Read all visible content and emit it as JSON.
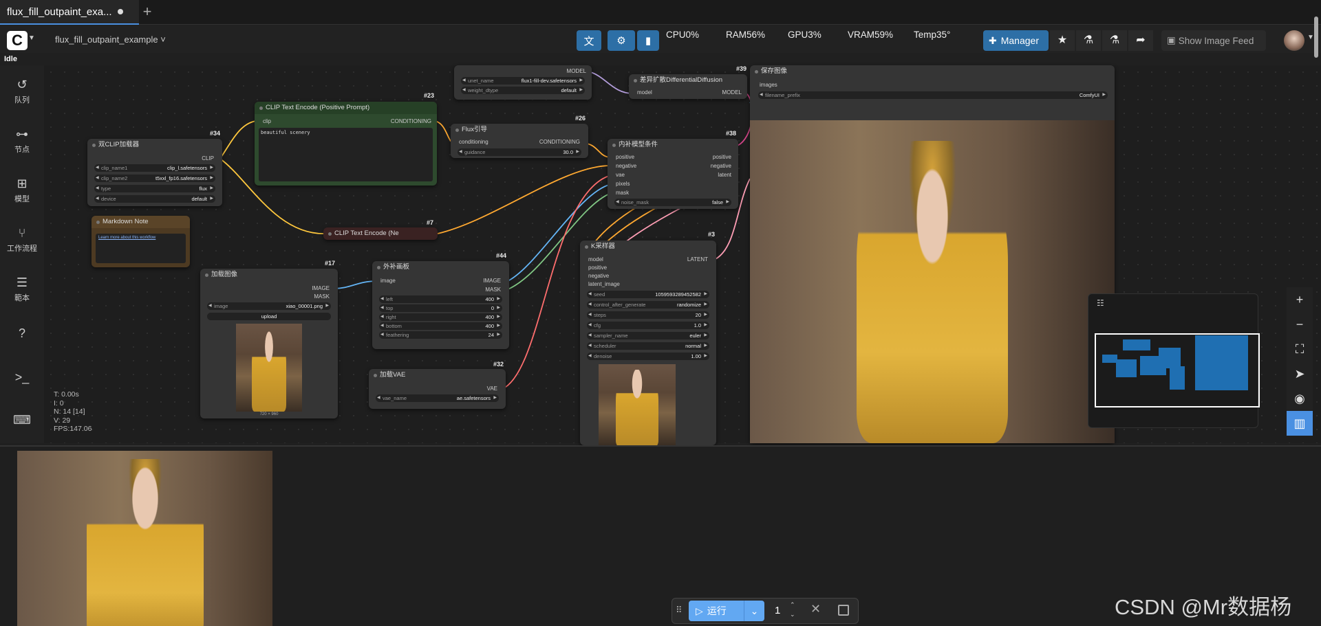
{
  "tabs": [
    {
      "label": "flux_fill_outpaint_exa..."
    }
  ],
  "topbar": {
    "workflow_name": "flux_fill_outpaint_example",
    "stats": {
      "cpu": "CPU0%",
      "ram": "RAM56%",
      "gpu": "GPU3%",
      "vram": "VRAM59%",
      "temp": "Temp35°"
    },
    "manager_label": "Manager",
    "show_feed_label": "Show Image Feed"
  },
  "status": "Idle",
  "sidebar": {
    "items": [
      {
        "label": "队列",
        "icon": "history-icon"
      },
      {
        "label": "节点",
        "icon": "node-icon"
      },
      {
        "label": "模型",
        "icon": "model-icon"
      },
      {
        "label": "工作流程",
        "icon": "workflow-icon"
      },
      {
        "label": "範本",
        "icon": "template-icon"
      }
    ]
  },
  "canvas_stats": {
    "t": "T: 0.00s",
    "i": "I: 0",
    "n": "N: 14 [14]",
    "v": "V: 29",
    "fps": "FPS:147.06"
  },
  "nodes": {
    "unet": {
      "out_model": "MODEL",
      "unet_name_k": "unet_name",
      "unet_name_v": "flux1-fill-dev.safetensors",
      "wdtype_k": "weight_dtype",
      "wdtype_v": "default"
    },
    "diffdiff": {
      "id": "#39",
      "title": "差异扩散DifferentialDiffusion",
      "in_model": "model",
      "out_model": "MODEL"
    },
    "save": {
      "title": "保存图像",
      "in_images": "images",
      "prefix_k": "filename_prefix",
      "prefix_v": "ComfyUI"
    },
    "clip_pos": {
      "id": "#23",
      "title": "CLIP Text Encode (Positive Prompt)",
      "in_clip": "clip",
      "out_cond": "CONDITIONING",
      "text": "beautiful scenery"
    },
    "flux_guide": {
      "id": "#26",
      "title": "Flux引导",
      "in_cond": "conditioning",
      "out_cond": "CONDITIONING",
      "g_k": "guidance",
      "g_v": "30.0"
    },
    "dualclip": {
      "id": "#34",
      "title": "双CLIP加载器",
      "out_clip": "CLIP",
      "c1_k": "clip_name1",
      "c1_v": "clip_l.safetensors",
      "c2_k": "clip_name2",
      "c2_v": "t5xxl_fp16.safetensors",
      "type_k": "type",
      "type_v": "flux",
      "dev_k": "device",
      "dev_v": "default"
    },
    "inpaint_cond": {
      "id": "#38",
      "title": "内补模型条件",
      "in_pos": "positive",
      "in_neg": "negative",
      "in_vae": "vae",
      "in_pix": "pixels",
      "in_mask": "mask",
      "out_pos": "positive",
      "out_neg": "negative",
      "out_lat": "latent",
      "nm_k": "noise_mask",
      "nm_v": "false"
    },
    "md_note": {
      "title": "Markdown Note",
      "link": "Learn more about this workflow"
    },
    "clip_neg": {
      "id": "#7",
      "title": "CLIP Text Encode (Ne"
    },
    "load_img": {
      "id": "#17",
      "title": "加载图像",
      "out_image": "IMAGE",
      "out_mask": "MASK",
      "img_k": "image",
      "img_v": "xiao_00001.png",
      "upload": "upload",
      "size": "720 × 960"
    },
    "pad": {
      "id": "#44",
      "title": "外补画板",
      "in_image": "image",
      "out_image": "IMAGE",
      "out_mask": "MASK",
      "left_k": "left",
      "left_v": "400",
      "top_k": "top",
      "top_v": "0",
      "right_k": "right",
      "right_v": "400",
      "bottom_k": "bottom",
      "bottom_v": "400",
      "feather_k": "feathering",
      "feather_v": "24"
    },
    "ksampler": {
      "id": "#3",
      "title": "K采样器",
      "in_model": "model",
      "in_pos": "positive",
      "in_neg": "negative",
      "in_lat": "latent_image",
      "out_lat": "LATENT",
      "seed_k": "seed",
      "seed_v": "1059593289452582",
      "cag_k": "control_after_generate",
      "cag_v": "randomize",
      "steps_k": "steps",
      "steps_v": "20",
      "cfg_k": "cfg",
      "cfg_v": "1.0",
      "sampler_k": "sampler_name",
      "sampler_v": "euler",
      "sched_k": "scheduler",
      "sched_v": "normal",
      "denoise_k": "denoise",
      "denoise_v": "1.00"
    },
    "vae": {
      "id": "#32",
      "title": "加载VAE",
      "out_vae": "VAE",
      "vn_k": "vae_name",
      "vn_v": "ae.safetensors"
    }
  },
  "runbar": {
    "run_label": "运行",
    "count": "1"
  },
  "watermark": "CSDN @Mr数据杨",
  "colors": {
    "accent": "#2d6fa6",
    "run": "#62a8f2",
    "clip_pos_node": "#2e4a2e",
    "note_node": "#4d3a22",
    "neg_node": "#3a2222"
  }
}
